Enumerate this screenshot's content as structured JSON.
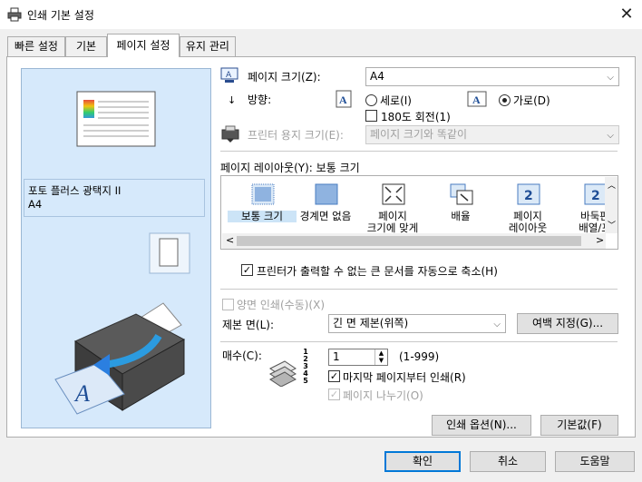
{
  "window": {
    "title": "인쇄 기본 설정",
    "close_glyph": "✕"
  },
  "tabs": [
    {
      "label": "빠른 설정",
      "active": false
    },
    {
      "label": "기본",
      "active": false
    },
    {
      "label": "페이지 설정",
      "active": true
    },
    {
      "label": "유지 관리",
      "active": false
    }
  ],
  "preview": {
    "media_line1": "포토 플러스 광택지 II",
    "media_line2": "A4"
  },
  "page_size": {
    "label": "페이지 크기(Z):",
    "value": "A4"
  },
  "orientation": {
    "label": "방향:",
    "portrait_label": "세로(I)",
    "portrait_selected": false,
    "landscape_label": "가로(D)",
    "landscape_selected": true,
    "rotate180_label": "180도 회전(1)",
    "rotate180_checked": false
  },
  "printer_paper": {
    "label": "프린터 용지 크기(E):",
    "value": "페이지 크기와 똑같이"
  },
  "page_layout": {
    "label": "페이지 레이아웃(Y):",
    "current": "보통 크기",
    "items": [
      {
        "line1": "보통 크기",
        "line2": "",
        "selected": true,
        "icon": "normal-size-icon"
      },
      {
        "line1": "경계면 없음",
        "line2": "",
        "selected": false,
        "icon": "borderless-icon"
      },
      {
        "line1": "페이지",
        "line2": "크기에 맞게",
        "selected": false,
        "icon": "fit-to-page-icon"
      },
      {
        "line1": "배율",
        "line2": "",
        "selected": false,
        "icon": "scaled-icon"
      },
      {
        "line1": "페이지",
        "line2": "레이아웃",
        "selected": false,
        "icon": "page-layout-icon"
      },
      {
        "line1": "바둑판",
        "line2": "배열/포",
        "selected": false,
        "icon": "tiling-icon"
      }
    ]
  },
  "auto_reduce": {
    "label": "프린터가 출력할 수 없는 큰 문서를 자동으로 축소(H)",
    "checked": true
  },
  "duplex": {
    "label": "양면 인쇄(수동)(X)",
    "checked": false
  },
  "binding": {
    "label": "제본 면(L):",
    "value": "긴 면 제본(위쪽)",
    "margin_button": "여백 지정(G)..."
  },
  "copies": {
    "label": "매수(C):",
    "value": "1",
    "range": "(1-999)",
    "reverse_label": "마지막 페이지부터 인쇄(R)",
    "reverse_checked": true,
    "collate_label": "페이지 나누기(O)",
    "collate_checked": true,
    "collate_digits": "12345"
  },
  "buttons": {
    "print_options": "인쇄 옵션(N)...",
    "defaults": "기본값(F)",
    "ok": "확인",
    "cancel": "취소",
    "help": "도움말"
  },
  "colors": {
    "accent": "#0078d7",
    "preview_bg": "#d6e9fb",
    "selection_bg": "#cce4f7"
  }
}
